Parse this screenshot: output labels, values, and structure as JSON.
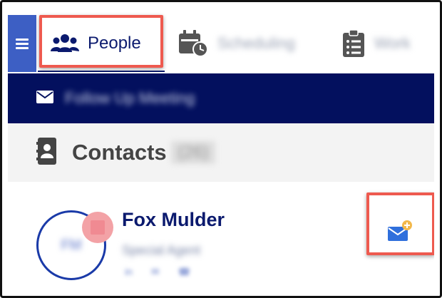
{
  "tabs": [
    {
      "label": "People",
      "icon": "people-icon",
      "active": true
    },
    {
      "label": "Scheduling",
      "icon": "calendar-clock-icon",
      "active": false
    },
    {
      "label": "Work",
      "icon": "clipboard-list-icon",
      "active": false
    }
  ],
  "banner": {
    "text": "Follow Up Meeting",
    "icon": "envelope-icon"
  },
  "contacts": {
    "title": "Contacts",
    "count": "(26)",
    "icon": "address-book-icon"
  },
  "contact": {
    "name": "Fox Mulder",
    "role": "Special Agent",
    "initials": "FM",
    "links": [
      "in",
      "✉",
      "☎"
    ]
  },
  "colors": {
    "brand_navy": "#0b1a6e",
    "banner_bg": "#03105e",
    "menu_blue": "#3d5fc4",
    "highlight": "#ee5a4f",
    "email_icon_blue": "#2f6fdc",
    "plus_badge": "#f2b84b"
  }
}
